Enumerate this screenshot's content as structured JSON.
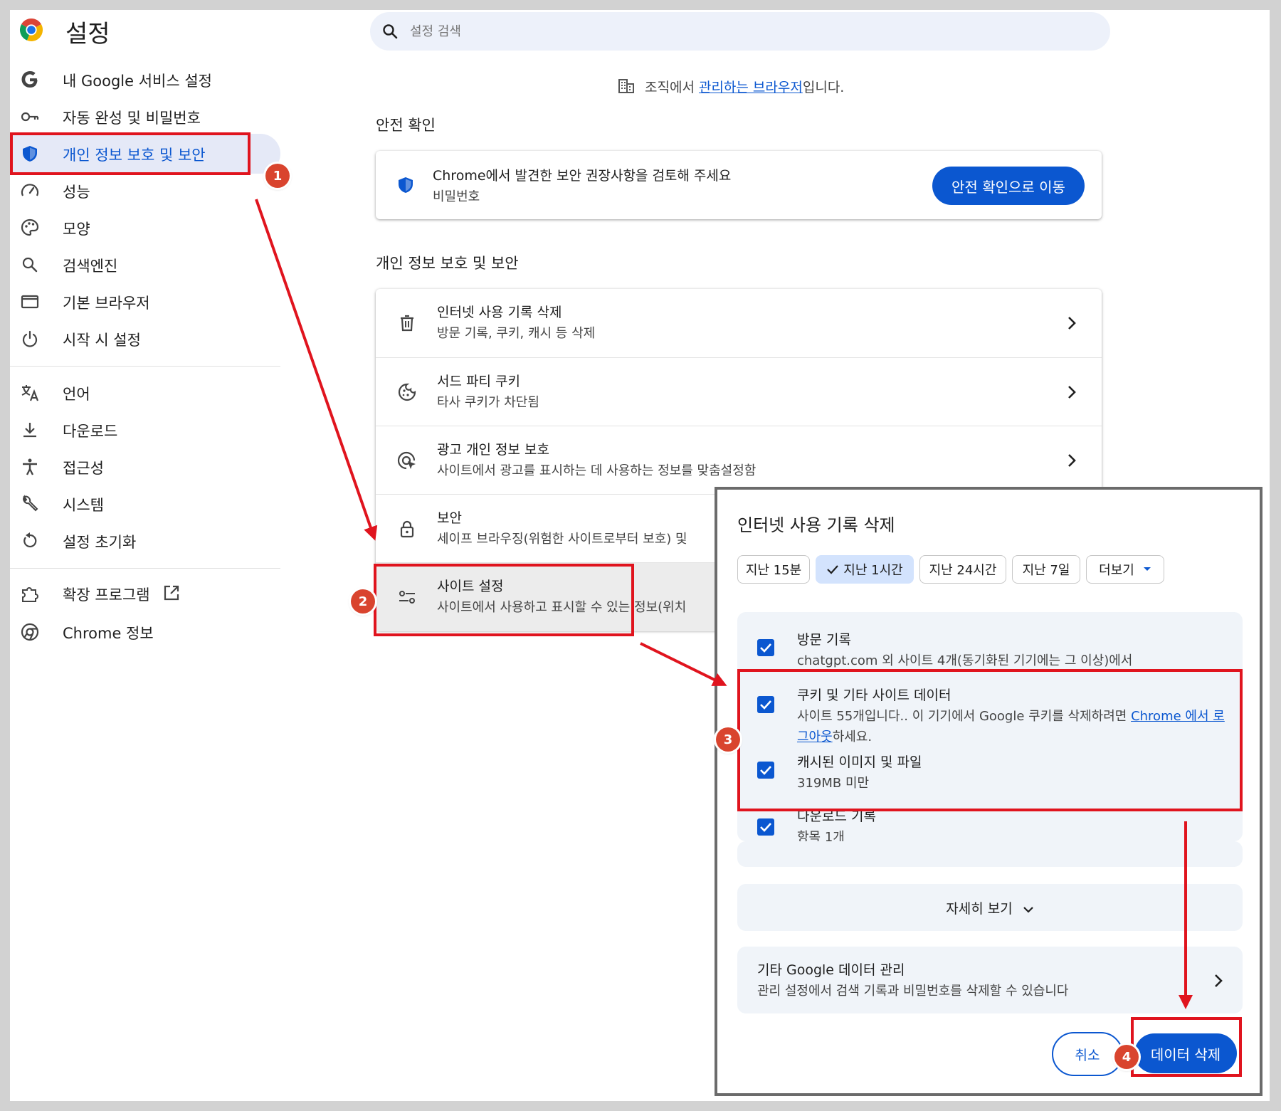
{
  "app": {
    "title": "설정"
  },
  "search": {
    "placeholder": "설정 검색"
  },
  "managed": {
    "prefix": "조직에서 ",
    "link": "관리하는 브라우저",
    "suffix": "입니다."
  },
  "sidebar": {
    "items": [
      {
        "label": "내 Google 서비스 설정",
        "icon": "google-g-icon"
      },
      {
        "label": "자동 완성 및 비밀번호",
        "icon": "key-icon"
      },
      {
        "label": "개인 정보 보호 및 보안",
        "icon": "shield-icon",
        "active": true
      },
      {
        "label": "성능",
        "icon": "speedometer-icon"
      },
      {
        "label": "모양",
        "icon": "palette-icon"
      },
      {
        "label": "검색엔진",
        "icon": "search-icon"
      },
      {
        "label": "기본 브라우저",
        "icon": "browser-window-icon"
      },
      {
        "label": "시작 시 설정",
        "icon": "power-icon"
      },
      {
        "label": "언어",
        "icon": "translate-icon"
      },
      {
        "label": "다운로드",
        "icon": "download-icon"
      },
      {
        "label": "접근성",
        "icon": "accessibility-icon"
      },
      {
        "label": "시스템",
        "icon": "wrench-icon"
      },
      {
        "label": "설정 초기화",
        "icon": "reset-icon"
      },
      {
        "label": "확장 프로그램",
        "icon": "puzzle-icon"
      },
      {
        "label": "Chrome 정보",
        "icon": "chrome-icon"
      }
    ]
  },
  "safety": {
    "section_title": "안전 확인",
    "title": "Chrome에서 발견한 보안 권장사항을 검토해 주세요",
    "subtitle": "비밀번호",
    "button": "안전 확인으로 이동"
  },
  "privacy": {
    "section_title": "개인 정보 보호 및 보안",
    "rows": [
      {
        "title": "인터넷 사용 기록 삭제",
        "subtitle": "방문 기록, 쿠키, 캐시 등 삭제",
        "icon": "trash-icon"
      },
      {
        "title": "서드 파티 쿠키",
        "subtitle": "타사 쿠키가 차단됨",
        "icon": "cookie-icon"
      },
      {
        "title": "광고 개인 정보 보호",
        "subtitle": "사이트에서 광고를 표시하는 데 사용하는 정보를 맞춤설정함",
        "icon": "ad-privacy-icon"
      },
      {
        "title": "보안",
        "subtitle": "세이프 브라우징(위험한 사이트로부터 보호) 및",
        "icon": "lock-icon"
      },
      {
        "title": "사이트 설정",
        "subtitle": "사이트에서 사용하고 표시할 수 있는 정보(위치",
        "icon": "tune-icon"
      }
    ]
  },
  "dialog": {
    "title": "인터넷 사용 기록 삭제",
    "chips": [
      "지난 15분",
      "지난 1시간",
      "지난 24시간",
      "지난 7일",
      "더보기"
    ],
    "selected_chip": "지난 1시간",
    "items": [
      {
        "title": "방문 기록",
        "desc": "chatgpt.com 외 사이트 4개(동기화된 기기에는 그 이상)에서",
        "checked": true
      },
      {
        "title": "쿠키 및 기타 사이트 데이터",
        "desc": "사이트 55개입니다.. 이 기기에서 Google 쿠키를 삭제하려면 ",
        "desc_link": "Chrome 에서 로그아웃",
        "desc_suffix": "하세요.",
        "checked": true
      },
      {
        "title": "캐시된 이미지 및 파일",
        "desc": "319MB 미만",
        "checked": true
      },
      {
        "title": "다운로드 기록",
        "desc": "항목 1개",
        "checked": true
      }
    ],
    "more_label": "자세히 보기",
    "google_title": "기타 Google 데이터 관리",
    "google_desc": "관리 설정에서 검색 기록과 비밀번호를 삭제할 수 있습니다",
    "cancel": "취소",
    "delete": "데이터 삭제"
  },
  "annotations": {
    "steps": [
      "1",
      "2",
      "3",
      "4"
    ],
    "color": "#e0141e",
    "badge_color": "#d9442e"
  },
  "colors": {
    "accent": "#0b57d0",
    "selected_chip": "#d3e3fd",
    "panel": "#f0f4f9"
  }
}
